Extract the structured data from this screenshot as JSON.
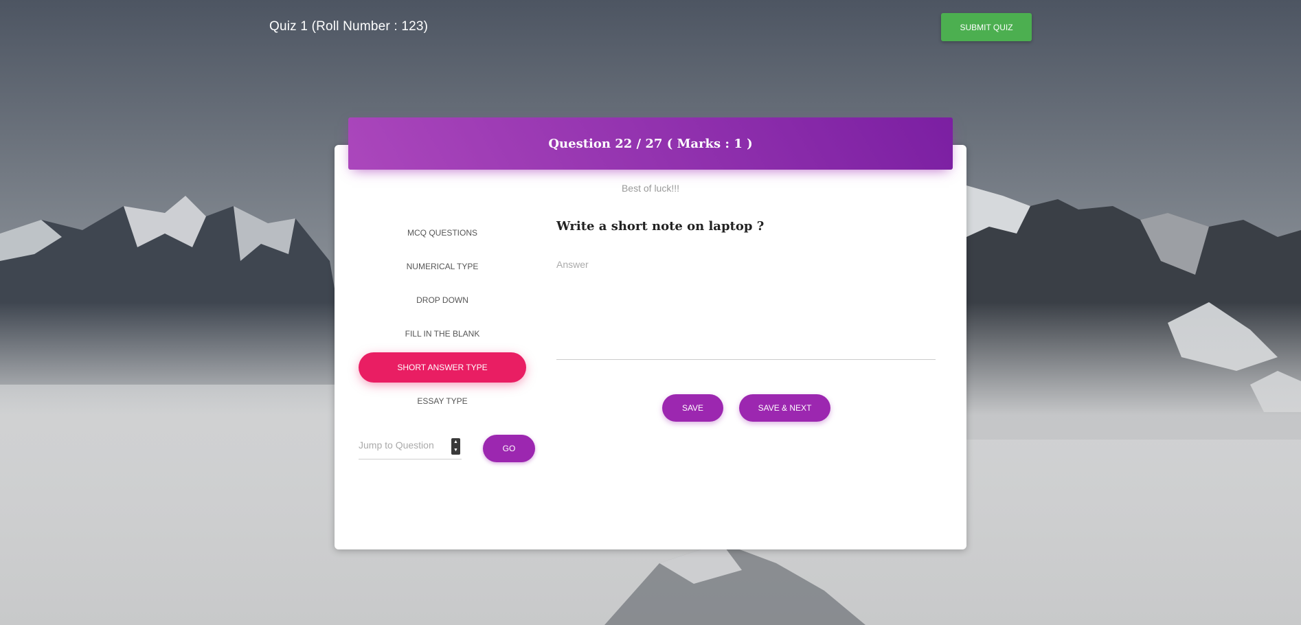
{
  "header": {
    "quiz_title": "Quiz 1 (Roll Number : 123)",
    "submit_label": "SUBMIT QUIZ"
  },
  "card": {
    "question_heading": "Question 22 / 27 ( Marks : 1 )",
    "subtitle": "Best of luck!!!"
  },
  "nav": {
    "items": [
      {
        "label": "MCQ QUESTIONS",
        "active": false
      },
      {
        "label": "NUMERICAL TYPE",
        "active": false
      },
      {
        "label": "DROP DOWN",
        "active": false
      },
      {
        "label": "FILL IN THE BLANK",
        "active": false
      },
      {
        "label": "SHORT ANSWER TYPE",
        "active": true
      },
      {
        "label": "ESSAY TYPE",
        "active": false
      }
    ],
    "jump_placeholder": "Jump to Question",
    "go_label": "GO"
  },
  "question": {
    "text": "Write a short note on laptop ?",
    "answer_placeholder": "Answer",
    "answer_value": "",
    "save_label": "SAVE",
    "save_next_label": "SAVE & NEXT"
  },
  "colors": {
    "header_gradient_start": "#ab47bc",
    "header_gradient_end": "#7b1fa2",
    "active_tab": "#e91e63",
    "primary_button": "#9c27b0",
    "submit_button": "#4caf50"
  },
  "icons": {
    "spinner_up": "chevron-up-icon",
    "spinner_down": "chevron-down-icon"
  }
}
